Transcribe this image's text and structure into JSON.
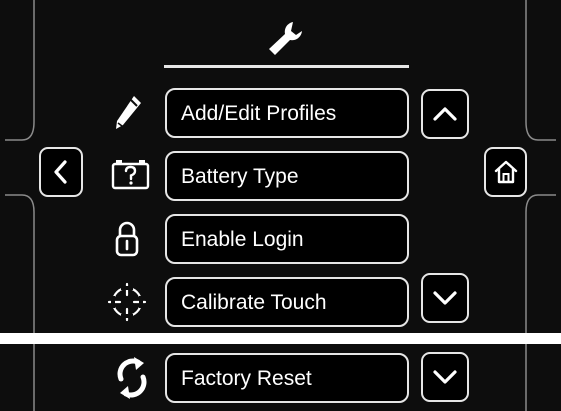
{
  "menu": {
    "add_edit_profiles": "Add/Edit Profiles",
    "battery_type": "Battery Type",
    "enable_login": "Enable Login",
    "calibrate_touch": "Calibrate Touch",
    "factory_reset": "Factory Reset"
  },
  "icons": {
    "header": "wrench-icon",
    "add_edit_profiles": "pencil-icon",
    "battery_type": "battery-question-icon",
    "enable_login": "padlock-icon",
    "calibrate_touch": "crosshair-icon",
    "factory_reset": "reset-arrows-icon",
    "back": "chevron-left-icon",
    "home": "home-icon",
    "scroll_up": "chevron-up-icon",
    "scroll_down": "chevron-down-icon"
  },
  "colors": {
    "background": "#0d0d0d",
    "foreground": "#e6e6e6"
  }
}
